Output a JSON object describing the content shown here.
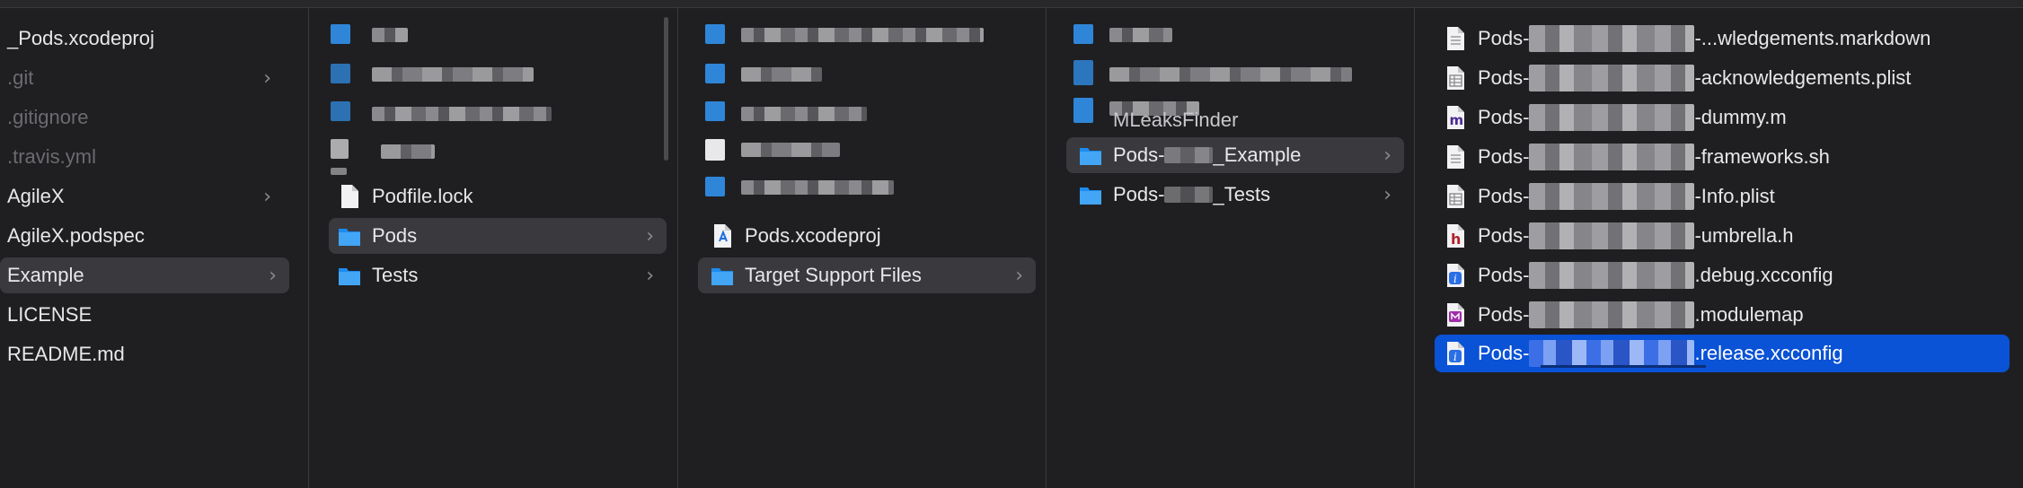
{
  "icons": {
    "folder_color": "#2f86d8",
    "selection_color": "#0a52d6",
    "highlight_color": "#3a3a3e"
  },
  "col1": {
    "items": [
      {
        "label": "_Pods.xcodeproj",
        "dim": false,
        "chevron": false
      },
      {
        "label": ".git",
        "dim": true,
        "chevron": true
      },
      {
        "label": ".gitignore",
        "dim": true,
        "chevron": false
      },
      {
        "label": ".travis.yml",
        "dim": true,
        "chevron": false
      },
      {
        "label": "AgileX",
        "dim": false,
        "chevron": true
      },
      {
        "label": "AgileX.podspec",
        "dim": false,
        "chevron": false
      },
      {
        "label": "Example",
        "dim": false,
        "chevron": true,
        "highlighted": true
      },
      {
        "label": "LICENSE",
        "dim": false,
        "chevron": false
      },
      {
        "label": "README.md",
        "dim": false,
        "chevron": false
      }
    ]
  },
  "col2": {
    "items": [
      {
        "label": "Podfile.lock",
        "icon": "document-icon"
      },
      {
        "label": "Pods",
        "icon": "folder-icon",
        "highlighted": true
      },
      {
        "label": "Tests",
        "icon": "folder-icon"
      }
    ]
  },
  "col3": {
    "items": [
      {
        "label": "Pods.xcodeproj",
        "icon": "xcodeproj-icon"
      },
      {
        "label": "Target Support Files",
        "icon": "folder-icon",
        "highlighted": true
      }
    ]
  },
  "col4": {
    "partial_label": "MLeaksFinder",
    "items": [
      {
        "prefix": "Pods-",
        "suffix": "_Example",
        "highlighted": true
      },
      {
        "prefix": "Pods-",
        "suffix": "_Tests"
      }
    ]
  },
  "col5": {
    "items": [
      {
        "prefix": "Pods-",
        "suffix": "-...wledgements.markdown",
        "icon": "text-file-icon"
      },
      {
        "prefix": "Pods-",
        "suffix": "-acknowledgements.plist",
        "icon": "plist-file-icon"
      },
      {
        "prefix": "Pods-",
        "suffix": "-dummy.m",
        "icon": "objc-m-file-icon"
      },
      {
        "prefix": "Pods-",
        "suffix": "-frameworks.sh",
        "icon": "text-file-icon"
      },
      {
        "prefix": "Pods-",
        "suffix": "-Info.plist",
        "icon": "plist-file-icon"
      },
      {
        "prefix": "Pods-",
        "suffix": "-umbrella.h",
        "icon": "header-file-icon"
      },
      {
        "prefix": "Pods-",
        "suffix": ".debug.xcconfig",
        "icon": "xcconfig-file-icon"
      },
      {
        "prefix": "Pods-",
        "suffix": ".modulemap",
        "icon": "modulemap-file-icon"
      },
      {
        "prefix": "Pods-",
        "suffix": ".release.xcconfig",
        "icon": "xcconfig-file-icon",
        "selected": true
      }
    ]
  }
}
